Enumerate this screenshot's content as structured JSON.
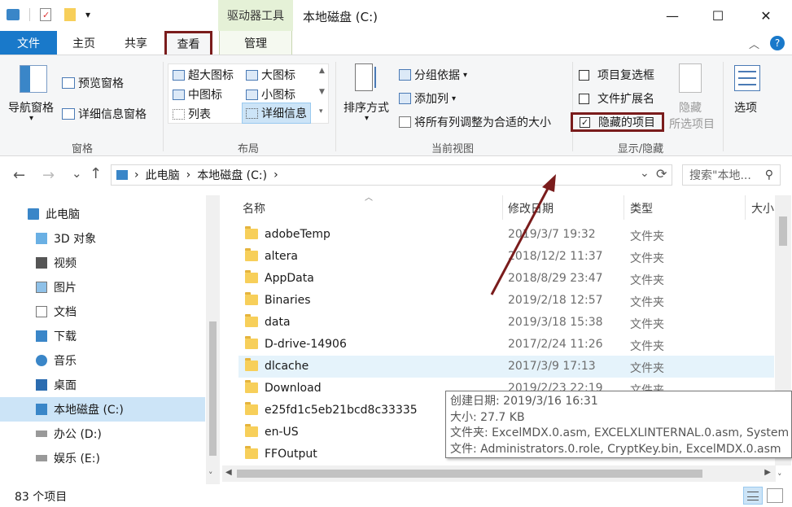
{
  "titlebar": {
    "drive_tools": "驱动器工具",
    "title": "本地磁盘 (C:)",
    "qa_dropdown": "▾",
    "min": "—",
    "max": "☐",
    "close": "✕"
  },
  "tabs": {
    "file": "文件",
    "home": "主页",
    "share": "共享",
    "view": "查看",
    "manage": "管理",
    "collapse": "︿",
    "help": "?"
  },
  "ribbon": {
    "panes": {
      "nav_pane": "导航窗格",
      "preview_pane": "预览窗格",
      "details_pane": "详细信息窗格",
      "label": "窗格"
    },
    "layout": {
      "extra_large": "超大图标",
      "large": "大图标",
      "medium": "中图标",
      "small": "小图标",
      "list": "列表",
      "details": "详细信息",
      "label": "布局"
    },
    "current_view": {
      "sort_by": "排序方式",
      "group_by": "分组依据",
      "add_columns": "添加列",
      "size_all": "将所有列调整为合适的大小",
      "label": "当前视图"
    },
    "show_hide": {
      "item_checkboxes": "项目复选框",
      "file_extensions": "文件扩展名",
      "hidden_items": "隐藏的项目",
      "hide_selected_1": "隐藏",
      "hide_selected_2": "所选项目",
      "label": "显示/隐藏"
    },
    "options": "选项"
  },
  "address": {
    "back": "←",
    "forward": "→",
    "recent": "⌄",
    "up": "↑",
    "crumb1": "此电脑",
    "crumb2": "本地磁盘 (C:)",
    "sep": "›",
    "search_placeholder": "搜索\"本地...",
    "refresh": "⟳"
  },
  "nav": [
    {
      "label": "此电脑"
    },
    {
      "label": "3D 对象"
    },
    {
      "label": "视频"
    },
    {
      "label": "图片"
    },
    {
      "label": "文档"
    },
    {
      "label": "下载"
    },
    {
      "label": "音乐"
    },
    {
      "label": "桌面"
    },
    {
      "label": "本地磁盘 (C:)"
    },
    {
      "label": "办公 (D:)"
    },
    {
      "label": "娱乐 (E:)"
    }
  ],
  "columns": {
    "name": "名称",
    "date": "修改日期",
    "type": "类型",
    "size": "大小"
  },
  "files": [
    {
      "name": "adobeTemp",
      "date": "2019/3/7 19:32",
      "type": "文件夹"
    },
    {
      "name": "altera",
      "date": "2018/12/2 11:37",
      "type": "文件夹"
    },
    {
      "name": "AppData",
      "date": "2018/8/29 23:47",
      "type": "文件夹"
    },
    {
      "name": "Binaries",
      "date": "2019/2/18 12:57",
      "type": "文件夹"
    },
    {
      "name": "data",
      "date": "2019/3/18 15:38",
      "type": "文件夹"
    },
    {
      "name": "D-drive-14906",
      "date": "2017/2/24 11:26",
      "type": "文件夹"
    },
    {
      "name": "dlcache",
      "date": "2017/3/9 17:13",
      "type": "文件夹"
    },
    {
      "name": "Download",
      "date": "2019/2/23 22:19",
      "type": "文件夹"
    },
    {
      "name": "e25fd1c5eb21bcd8c33335",
      "date": "",
      "type": ""
    },
    {
      "name": "en-US",
      "date": "",
      "type": ""
    },
    {
      "name": "FFOutput",
      "date": "",
      "type": ""
    }
  ],
  "tooltip": {
    "line1": "创建日期: 2019/3/16 16:31",
    "line2": "大小: 27.7 KB",
    "line3": "文件夹: ExcelMDX.0.asm, EXCELXLINTERNAL.0.asm, System",
    "line4": "文件: Administrators.0.role, CryptKey.bin, ExcelMDX.0.asm"
  },
  "status": {
    "count": "83 个项目"
  }
}
